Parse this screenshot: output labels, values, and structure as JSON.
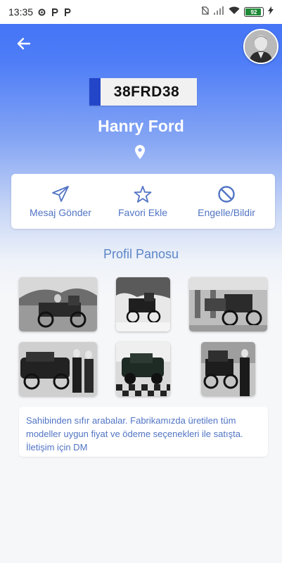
{
  "status_bar": {
    "time": "13:35",
    "notification_icons": [
      "settings-icon",
      "parking-app-icon",
      "parking-app-icon"
    ],
    "battery_percent": "92"
  },
  "header": {
    "back_icon": "arrow-left-icon",
    "avatar": "profile-avatar"
  },
  "profile": {
    "plate": "38FRD38",
    "name": "Hanry Ford",
    "location_icon": "map-pin-icon"
  },
  "actions": [
    {
      "label": "Mesaj Gönder",
      "icon": "send-icon"
    },
    {
      "label": "Favori Ekle",
      "icon": "star-icon"
    },
    {
      "label": "Engelle/Bildir",
      "icon": "block-icon"
    }
  ],
  "board": {
    "title": "Profil Panosu",
    "photos": [
      "vintage-car-photo-1",
      "vintage-car-photo-2",
      "vintage-car-photo-3",
      "vintage-car-photo-4",
      "vintage-car-photo-5",
      "vintage-car-photo-6"
    ]
  },
  "bio": {
    "text": "Sahibinden sıfır arabalar. Fabrikamızda üretilen tüm modeller uygun fiyat ve ödeme seçenekleri ile satışta. İletişim için DM"
  },
  "colors": {
    "header_gradient_top": "#3f6ef6",
    "accent": "#5174c4",
    "plate_strip": "#2346c9",
    "battery": "#1f8a37"
  }
}
